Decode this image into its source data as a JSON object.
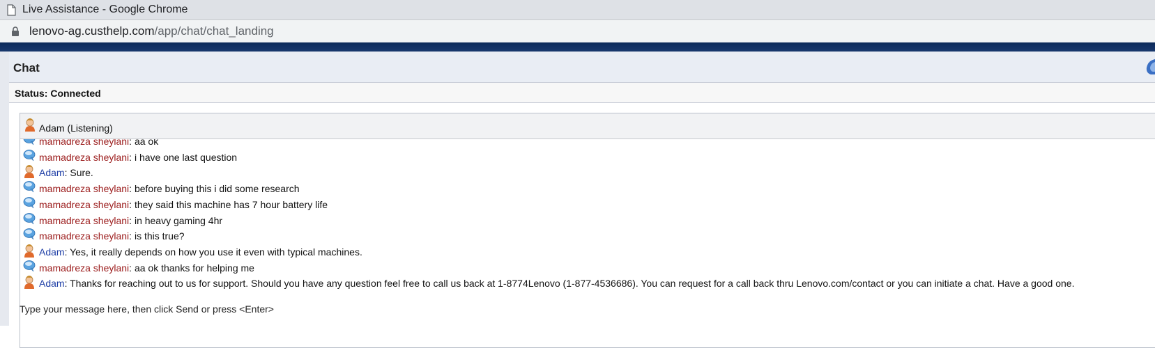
{
  "window": {
    "title": "Live Assistance - Google Chrome",
    "url_domain": "lenovo-ag.custhelp.com",
    "url_path": "/app/chat/chat_landing"
  },
  "chat": {
    "header_title": "Chat",
    "status_text": "Status: Connected",
    "agent_status": "Adam (Listening)",
    "footer_hint": "Type your message here, then click Send or press <Enter>"
  },
  "colors": {
    "customer_name": "#9b1b1b",
    "agent_name": "#1f3fa6",
    "header_band": "#0c2a5a"
  },
  "transcript": [
    {
      "role": "customer",
      "sender": "mamadreza sheylani",
      "text": "aa ok",
      "icon": "speech-bubble-icon"
    },
    {
      "role": "customer",
      "sender": "mamadreza sheylani",
      "text": "i have one last question",
      "icon": "speech-bubble-icon"
    },
    {
      "role": "agent",
      "sender": "Adam",
      "text": "Sure.",
      "icon": "agent-avatar-icon"
    },
    {
      "role": "customer",
      "sender": "mamadreza sheylani",
      "text": "before buying this i did some research",
      "icon": "speech-bubble-icon"
    },
    {
      "role": "customer",
      "sender": "mamadreza sheylani",
      "text": "they said this machine has 7 hour battery life",
      "icon": "speech-bubble-icon"
    },
    {
      "role": "customer",
      "sender": "mamadreza sheylani",
      "text": "in heavy gaming 4hr",
      "icon": "speech-bubble-icon"
    },
    {
      "role": "customer",
      "sender": "mamadreza sheylani",
      "text": "is this true?",
      "icon": "speech-bubble-icon"
    },
    {
      "role": "agent",
      "sender": "Adam",
      "text": "Yes, it really depends on how you use it even with typical machines.",
      "icon": "agent-avatar-icon"
    },
    {
      "role": "customer",
      "sender": "mamadreza sheylani",
      "text": "aa ok thanks for helping me",
      "icon": "speech-bubble-icon"
    },
    {
      "role": "agent",
      "sender": "Adam",
      "text": "Thanks for reaching out to us for support. Should you have any question feel free to call us back at 1-8774Lenovo (1-877-4536686). You can request for a call back thru Lenovo.com/contact or you can initiate a chat. Have a good one.",
      "icon": "agent-avatar-icon"
    }
  ]
}
